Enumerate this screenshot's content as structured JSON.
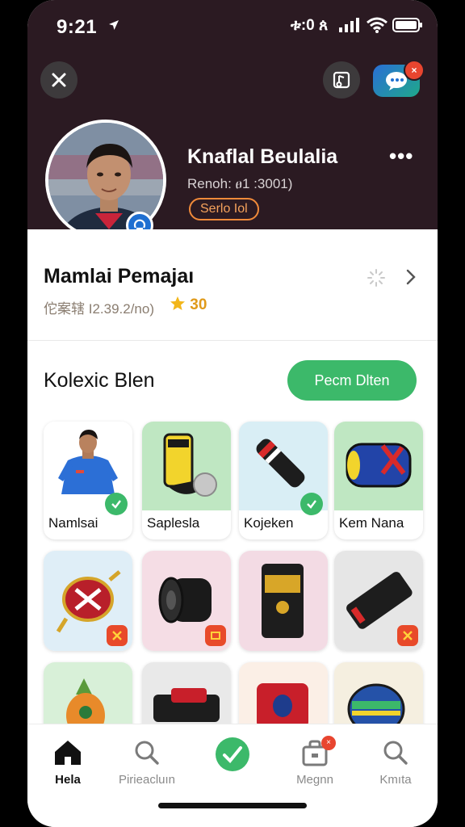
{
  "status_bar": {
    "time": "9:21",
    "carrier": "ቱ:0 ጰ"
  },
  "header": {
    "name": "Knaflal Beulalia",
    "subtitle": "Renoh: ፀ1 :3001)",
    "badge": "Serlo Iol",
    "more": "•••",
    "notification": "×"
  },
  "rating": {
    "title": "Mamlai Pemajaı",
    "subtitle": "佗案辖 I2.39.2/no)",
    "score": "30"
  },
  "collection": {
    "title": "Kolexic Blen",
    "button": "Pecm Dlten",
    "items": [
      {
        "label": "Namlsai",
        "bg": "#ffffff",
        "checked": true
      },
      {
        "label": "Saplesla",
        "bg": "#bfe7c2",
        "checked": false
      },
      {
        "label": "Kojeken",
        "bg": "#d9eef5",
        "checked": true
      },
      {
        "label": "Kem Nana",
        "bg": "#bfe7c2",
        "checked": false
      },
      {
        "label": "",
        "bg": "#dfeef7"
      },
      {
        "label": "",
        "bg": "#f5dde5"
      },
      {
        "label": "",
        "bg": "#f3dbe4"
      },
      {
        "label": "",
        "bg": "#e6e6e6"
      },
      {
        "label": "",
        "bg": "#d8f0d8"
      },
      {
        "label": "",
        "bg": "#e9e9e9"
      },
      {
        "label": "",
        "bg": "#fbefe6"
      },
      {
        "label": "",
        "bg": "#f5efe0"
      }
    ]
  },
  "bottom_nav": [
    {
      "label": "Hela",
      "icon": "home-icon"
    },
    {
      "label": "Pirieacluın",
      "icon": "search-icon"
    },
    {
      "label": "",
      "icon": "check-circle-icon"
    },
    {
      "label": "Megnn",
      "icon": "bag-icon",
      "badge": "×"
    },
    {
      "label": "Kmıta",
      "icon": "search-icon"
    }
  ],
  "colors": {
    "header": "#2b1a22",
    "accent_green": "#3cb96a",
    "badge_orange": "#f08a3a",
    "alert_red": "#e8452f"
  }
}
